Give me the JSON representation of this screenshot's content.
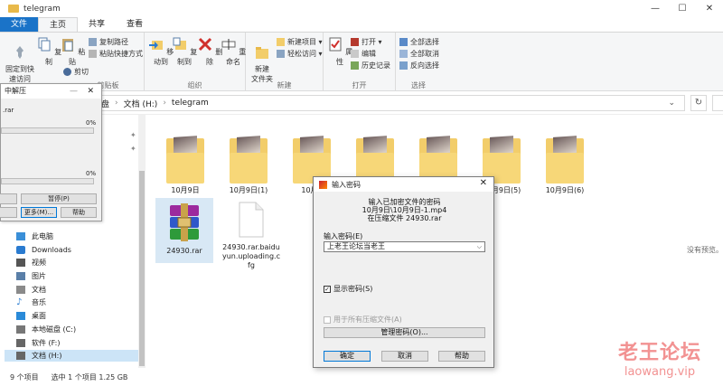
{
  "window": {
    "title": "telegram",
    "minimize": "—",
    "maximize": "☐",
    "close": "✕"
  },
  "tabs": [
    "文件",
    "主页",
    "共享",
    "查看"
  ],
  "ribbon": {
    "clipboard": {
      "pin": "固定到快\n速访问",
      "copy": "复制",
      "paste": "粘贴",
      "copy_path": "复制路径",
      "paste_shortcut": "粘贴快捷方式",
      "cut": "剪切",
      "label": "剪贴板"
    },
    "organize": {
      "move_to": "移动到",
      "copy_to": "复制到",
      "delete": "删除",
      "rename": "重命名",
      "label": "组织"
    },
    "new": {
      "new_folder": "新建\n文件夹",
      "new_item": "新建项目 ▾",
      "easy_access": "轻松访问 ▾",
      "label": "新建"
    },
    "open": {
      "properties": "属性",
      "open": "打开 ▾",
      "edit": "编辑",
      "history": "历史记录",
      "label": "打开"
    },
    "select": {
      "select_all": "全部选择",
      "select_none": "全部取消",
      "invert": "反向选择",
      "label": "选择"
    }
  },
  "address": {
    "part1": "盘",
    "part2": "文档 (H:)",
    "part3": "telegram",
    "dropdown": "⌄",
    "refresh": "↻"
  },
  "nav": [
    {
      "label": "此电脑",
      "color": "#3a8fd8"
    },
    {
      "label": "Downloads",
      "color": "#2a7bd0"
    },
    {
      "label": "视频",
      "color": "#555"
    },
    {
      "label": "图片",
      "color": "#5a7fa8"
    },
    {
      "label": "文档",
      "color": "#8a8a8a"
    },
    {
      "label": "音乐",
      "color": "#2a7bd0"
    },
    {
      "label": "桌面",
      "color": "#2a8ad8"
    },
    {
      "label": "本地磁盘 (C:)",
      "color": "#777"
    },
    {
      "label": "软件 (F:)",
      "color": "#666"
    },
    {
      "label": "文档 (H:)",
      "color": "#666"
    }
  ],
  "files": [
    {
      "name": "10月9日"
    },
    {
      "name": "10月9日(1)"
    },
    {
      "name": "10月9"
    },
    {
      "name": ""
    },
    {
      "name": ""
    },
    {
      "name": "10月9日(5)"
    },
    {
      "name": "10月9日(6)"
    }
  ],
  "rar_file": {
    "name": "24930.rar"
  },
  "uploading_file": {
    "name": "24930.rar.baidu\nyun.uploading.c\nfg"
  },
  "empty_hint": "没有预览。",
  "status": {
    "count": "9 个项目",
    "selected": "选中 1 个项目  1.25 GB"
  },
  "extract": {
    "title": "中解压",
    "file": ".rar",
    "pct1": "0%",
    "pct2": "0%",
    "pause": "暂停(P)",
    "more": "更多(M)...",
    "help": "帮助",
    "minimize": "—",
    "close": "✕",
    "progress1": 0,
    "progress2": 0
  },
  "password": {
    "title": "输入密码",
    "line1": "输入已加密文件的密码",
    "line2": "10月9日\\10月9日-1.mp4",
    "line3": "在压缩文件 24930.rar",
    "label": "输入密码(E)",
    "value": "上老王论坛当老王",
    "show_password": "显示密码(S)",
    "show_checked": true,
    "all_archives": "用于所有压缩文件(A)",
    "all_checked": false,
    "manage": "管理密码(O)...",
    "ok": "确定",
    "cancel": "取消",
    "help": "帮助",
    "close": "✕"
  },
  "watermark": {
    "big": "老王论坛",
    "small": "laowang.vip"
  }
}
